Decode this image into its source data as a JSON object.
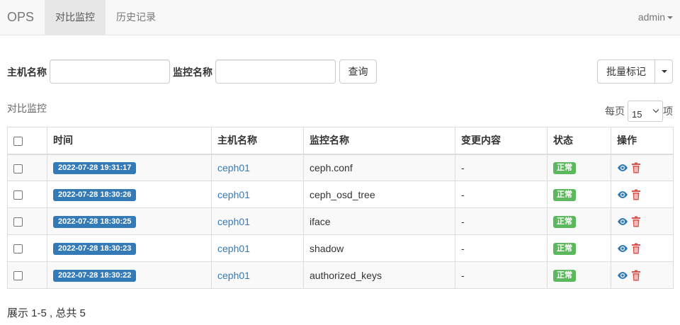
{
  "navbar": {
    "brand": "OPS",
    "tabs": [
      {
        "label": "对比监控",
        "active": true
      },
      {
        "label": "历史记录",
        "active": false
      }
    ],
    "user": "admin"
  },
  "search": {
    "host_label": "主机名称",
    "host_value": "",
    "monitor_label": "监控名称",
    "monitor_value": "",
    "query_button": "查询",
    "batch_button": "批量标记"
  },
  "section": {
    "title": "对比监控",
    "per_page_prefix": "每页",
    "per_page_value": "15",
    "per_page_suffix": "项"
  },
  "table": {
    "columns": [
      "时间",
      "主机名称",
      "监控名称",
      "变更内容",
      "状态",
      "操作"
    ],
    "rows": [
      {
        "time": "2022-07-28 19:31:17",
        "host": "ceph01",
        "monitor": "ceph.conf",
        "change": "-",
        "status": "正常"
      },
      {
        "time": "2022-07-28 18:30:26",
        "host": "ceph01",
        "monitor": "ceph_osd_tree",
        "change": "-",
        "status": "正常"
      },
      {
        "time": "2022-07-28 18:30:25",
        "host": "ceph01",
        "monitor": "iface",
        "change": "-",
        "status": "正常"
      },
      {
        "time": "2022-07-28 18:30:23",
        "host": "ceph01",
        "monitor": "shadow",
        "change": "-",
        "status": "正常"
      },
      {
        "time": "2022-07-28 18:30:22",
        "host": "ceph01",
        "monitor": "authorized_keys",
        "change": "-",
        "status": "正常"
      }
    ],
    "row_icons": [
      "eye-icon",
      "trash-icon"
    ]
  },
  "footer": {
    "summary": "展示 1-5 , 总共 5"
  },
  "colors": {
    "primary": "#337ab7",
    "success": "#5cb85c",
    "danger": "#d9534f",
    "navbar_bg": "#f8f8f8"
  }
}
